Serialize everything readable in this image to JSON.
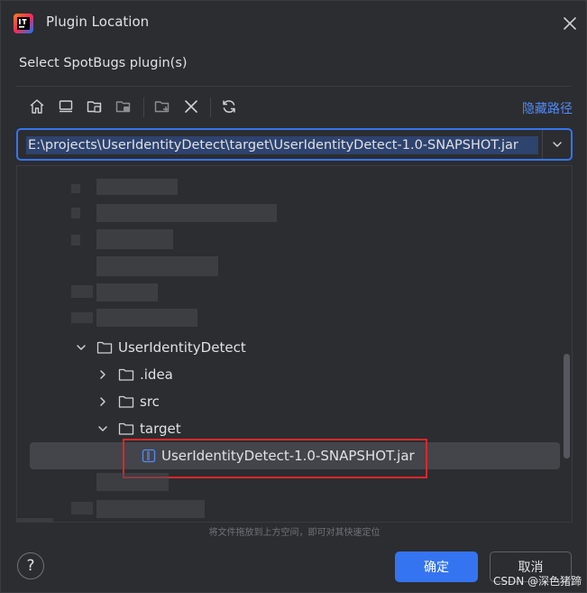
{
  "window": {
    "title": "Plugin Location",
    "close_icon": "close-icon",
    "app_icon": "intellij-idea-logo"
  },
  "subtitle": "Select SpotBugs plugin(s)",
  "toolbar": {
    "buttons": [
      "home-icon",
      "desktop-icon",
      "project-icon",
      "module-icon",
      "new-folder-icon",
      "delete-icon",
      "refresh-icon"
    ],
    "hide_path_label": "隐藏路径"
  },
  "path": {
    "value": "E:\\projects\\UserIdentityDetect\\target\\UserIdentityDetect-1.0-SNAPSHOT.jar"
  },
  "tree": {
    "items": [
      {
        "label": "UserIdentityDetect",
        "expanded": true,
        "type": "folder"
      },
      {
        "label": ".idea",
        "expanded": false,
        "type": "folder"
      },
      {
        "label": "src",
        "expanded": false,
        "type": "folder"
      },
      {
        "label": "target",
        "expanded": true,
        "type": "folder"
      },
      {
        "label": "UserIdentityDetect-1.0-SNAPSHOT.jar",
        "type": "jar",
        "selected": true
      }
    ]
  },
  "drop_hint": "将文件拖放到上方空间，即可对其快速定位",
  "footer": {
    "help_label": "?",
    "ok_label": "确定",
    "cancel_label": "取消"
  },
  "watermark": "CSDN @深色猪蹄",
  "colors": {
    "background": "#2b2d30",
    "accent": "#3574f0",
    "link": "#548af7",
    "selection": "#43454a",
    "highlight_border": "#e0262a"
  }
}
